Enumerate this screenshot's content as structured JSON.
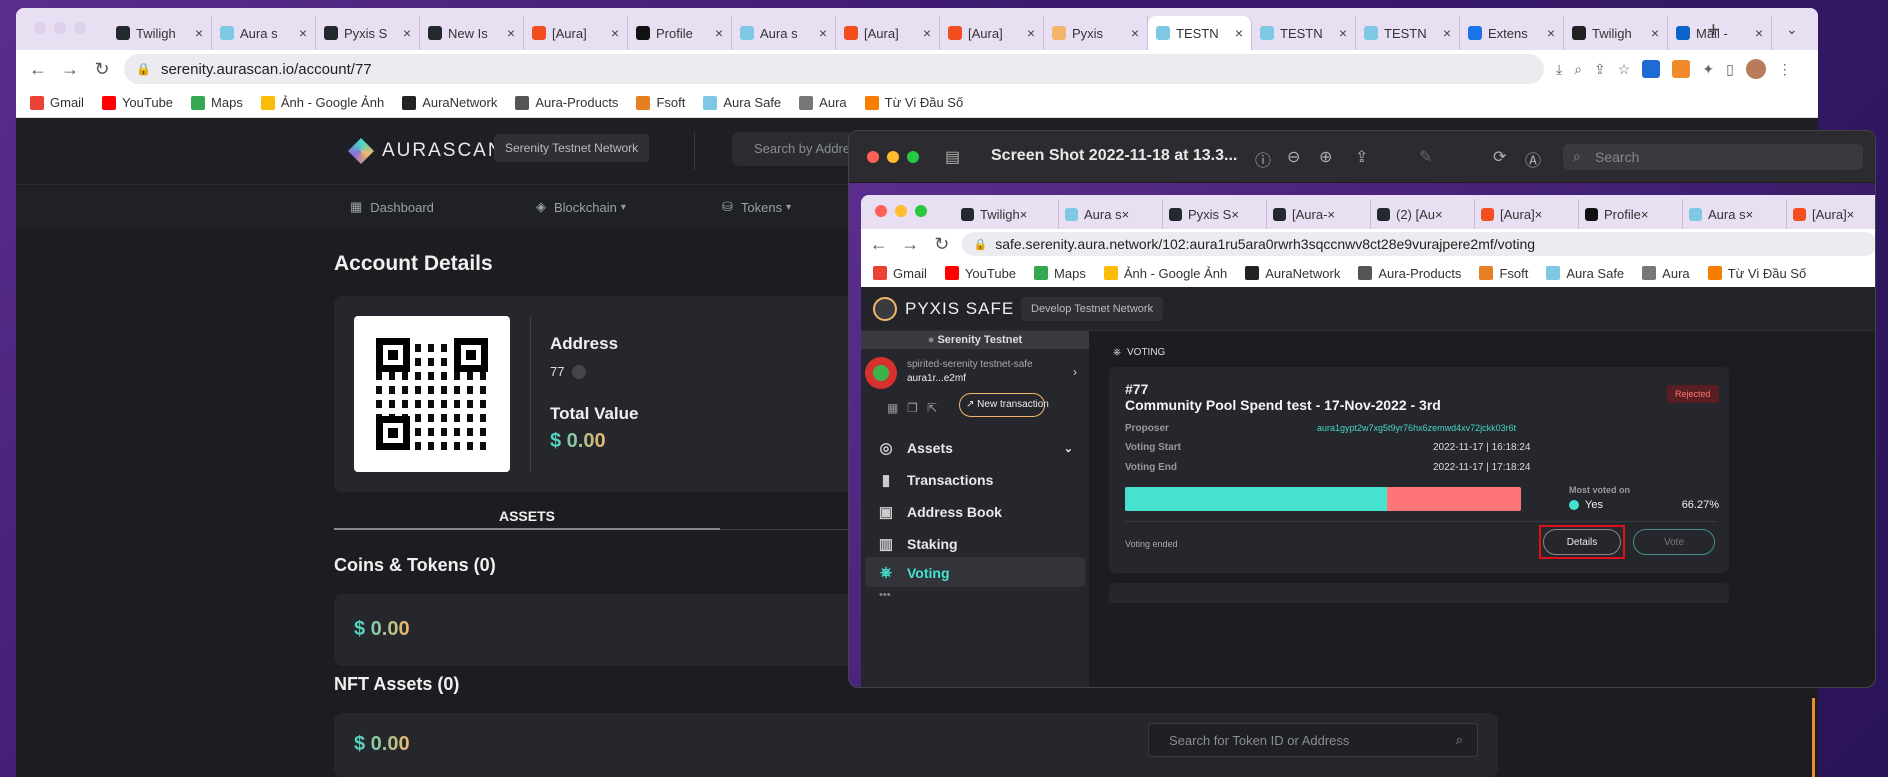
{
  "outer_browser": {
    "tabs": [
      {
        "label": "Twiligh",
        "icon": "github-icon"
      },
      {
        "label": "Aura s",
        "icon": "aura-icon"
      },
      {
        "label": "Pyxis S",
        "icon": "github-icon"
      },
      {
        "label": "New Is",
        "icon": "github-icon"
      },
      {
        "label": "[Aura]",
        "icon": "figma-icon"
      },
      {
        "label": "Profile",
        "icon": "notion-icon"
      },
      {
        "label": "Aura s",
        "icon": "aura-icon"
      },
      {
        "label": "[Aura]",
        "icon": "figma-icon"
      },
      {
        "label": "[Aura]",
        "icon": "figma-icon"
      },
      {
        "label": "Pyxis",
        "icon": "pyxis-icon"
      },
      {
        "label": "TESTN",
        "icon": "aura-icon"
      },
      {
        "label": "TESTN",
        "icon": "aura-icon"
      },
      {
        "label": "TESTN",
        "icon": "aura-icon"
      },
      {
        "label": "Extens",
        "icon": "puzzle-icon"
      },
      {
        "label": "Twiligh",
        "icon": "angular-icon"
      },
      {
        "label": "Mail -",
        "icon": "outlook-icon"
      }
    ],
    "url": "serenity.aurascan.io/account/77",
    "bookmarks": [
      {
        "label": "Gmail",
        "icon": "gmail-icon"
      },
      {
        "label": "YouTube",
        "icon": "youtube-icon"
      },
      {
        "label": "Maps",
        "icon": "maps-icon"
      },
      {
        "label": "Ảnh - Google Ảnh",
        "icon": "photos-icon"
      },
      {
        "label": "AuraNetwork",
        "icon": "auranetwork-icon"
      },
      {
        "label": "Aura-Products",
        "icon": "products-icon"
      },
      {
        "label": "Fsoft",
        "icon": "fsoft-icon"
      },
      {
        "label": "Aura Safe",
        "icon": "aura-icon"
      },
      {
        "label": "Aura",
        "icon": "folder-icon"
      },
      {
        "label": "Từ Vi Đầu Số",
        "icon": "blogger-icon"
      }
    ]
  },
  "aurascan": {
    "logo": "AURASCAN",
    "network_badge": "Serenity Testnet Network",
    "search_placeholder": "Search by Address",
    "nav": [
      "Dashboard",
      "Blockchain",
      "Tokens"
    ],
    "page_title": "Account Details",
    "address_label": "Address",
    "address_value": "77",
    "total_value_label": "Total Value",
    "total_value": "$ 0.00",
    "assets_tab": "ASSETS",
    "coins_title": "Coins & Tokens (0)",
    "coins_value": "$ 0.00",
    "nft_title": "NFT Assets (0)",
    "nft_value": "$ 0.00",
    "nft_search_placeholder": "Search for Token ID or Address"
  },
  "preview": {
    "title": "Screen Shot 2022-11-18 at 13.3...",
    "search_placeholder": "Search"
  },
  "inner_browser": {
    "tabs": [
      {
        "label": "Twiligh",
        "icon": "github-icon"
      },
      {
        "label": "Aura s",
        "icon": "aura-icon"
      },
      {
        "label": "Pyxis S",
        "icon": "github-icon"
      },
      {
        "label": "[Aura-",
        "icon": "github-icon"
      },
      {
        "label": "(2) [Au",
        "icon": "github-icon"
      },
      {
        "label": "[Aura]",
        "icon": "figma-icon"
      },
      {
        "label": "Profile",
        "icon": "notion-icon"
      },
      {
        "label": "Aura s",
        "icon": "aura-icon"
      },
      {
        "label": "[Aura]",
        "icon": "figma-icon"
      }
    ],
    "url": "safe.serenity.aura.network/102:aura1ru5ara0rwrh3sqccnwv8ct28e9vurajpere2mf/voting",
    "bookmarks": [
      {
        "label": "Gmail",
        "icon": "gmail-icon"
      },
      {
        "label": "YouTube",
        "icon": "youtube-icon"
      },
      {
        "label": "Maps",
        "icon": "maps-icon"
      },
      {
        "label": "Ảnh - Google Ảnh",
        "icon": "photos-icon"
      },
      {
        "label": "AuraNetwork",
        "icon": "auranetwork-icon"
      },
      {
        "label": "Aura-Products",
        "icon": "products-icon"
      },
      {
        "label": "Fsoft",
        "icon": "fsoft-icon"
      },
      {
        "label": "Aura Safe",
        "icon": "aura-icon"
      },
      {
        "label": "Aura",
        "icon": "folder-icon"
      },
      {
        "label": "Từ Vi Đầu Số",
        "icon": "blogger-icon"
      }
    ]
  },
  "pyxis": {
    "logo": "PYXIS SAFE",
    "network_badge": "Develop Testnet Network",
    "network_name": "Serenity Testnet",
    "safe_name": "spirited-serenity testnet-safe",
    "safe_address": "aura1r...e2mf",
    "new_transaction": "New transaction",
    "menu": [
      "Assets",
      "Transactions",
      "Address Book",
      "Staking",
      "Voting"
    ],
    "section_label": "VOTING",
    "proposal": {
      "id": "#77",
      "title": "Community Pool Spend test - 17-Nov-2022 - 3rd",
      "status": "Rejected",
      "proposer_label": "Proposer",
      "proposer": "aura1gypt2w7xg5t9yr76hx6zemwd4xv72jckk03r6t",
      "voting_start_label": "Voting Start",
      "voting_start": "2022-11-17 | 16:18:24",
      "voting_end_label": "Voting End",
      "voting_end": "2022-11-17 | 17:18:24",
      "yes_share": 0.6627,
      "most_voted_label": "Most voted on",
      "most_voted_option": "Yes",
      "most_voted_percent": "66.27%",
      "voting_state": "Voting ended",
      "details_button": "Details",
      "vote_button": "Vote"
    },
    "colors": {
      "yes": "#45e3cf",
      "no": "#ff7477",
      "highlight": "#e0101a"
    }
  }
}
